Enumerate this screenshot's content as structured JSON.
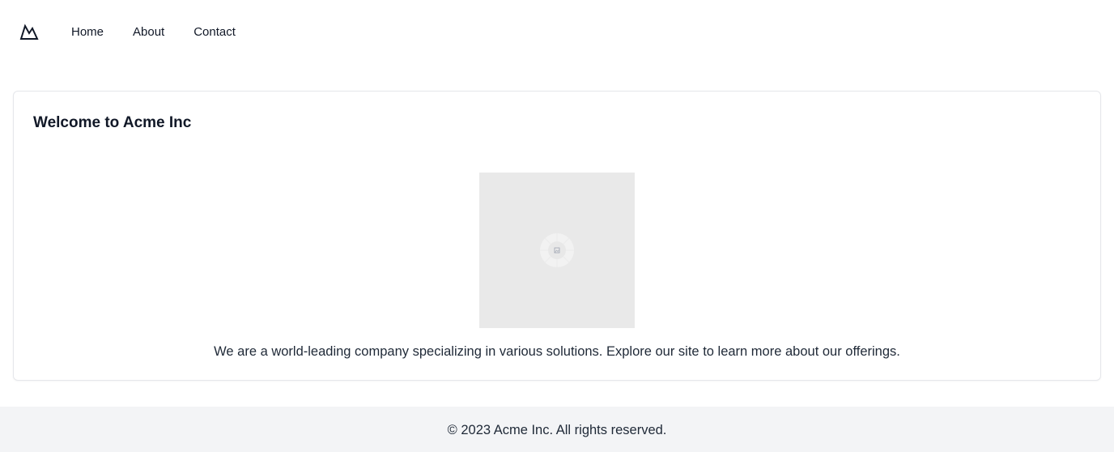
{
  "header": {
    "logo_icon": "mountain-icon",
    "nav": [
      {
        "label": "Home"
      },
      {
        "label": "About"
      },
      {
        "label": "Contact"
      }
    ]
  },
  "main": {
    "title": "Welcome to Acme Inc",
    "image_icon": "image-placeholder-icon",
    "description": "We are a world-leading company specializing in various solutions. Explore our site to learn more about our offerings."
  },
  "footer": {
    "copyright": "© 2023 Acme Inc. All rights reserved."
  },
  "colors": {
    "text": "#111827",
    "border": "#e5e7eb",
    "footer_bg": "#f3f4f6",
    "placeholder_bg": "#e9e9e9"
  }
}
